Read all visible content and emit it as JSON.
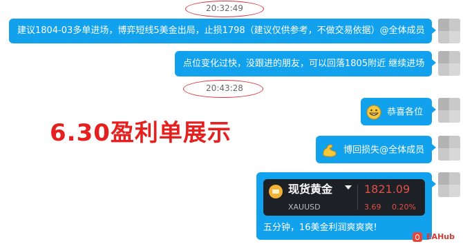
{
  "timestamps": [
    "20:32:49",
    "20:43:28"
  ],
  "messages": [
    {
      "text": "建议1804-03多单进场，博弈短线5美金出局，止损1798（建议仅供参考，不做交易依据）@全体成员"
    },
    {
      "text": "点位变化过快，没跟进的朋友，可以回落1805附近 继续进场"
    },
    {
      "text": "恭喜各位",
      "emoji": "grin-emoji-icon"
    },
    {
      "text": "博回损失@全体成员",
      "emoji": "flex-arm-emoji-icon"
    },
    {
      "text": "五分钟，16美金利润爽爽爽!"
    }
  ],
  "promo_text": "6.30盈利单展示",
  "quote_card": {
    "name": "现货黄金",
    "symbol": "XAUUSD",
    "price": "1821.09",
    "change": "3.69",
    "change_pct": "0.20%",
    "price_color": "#e2504a"
  },
  "watermark": "EAHub",
  "colors": {
    "bubble": "#12a1ec",
    "highlight": "#e0303a"
  }
}
